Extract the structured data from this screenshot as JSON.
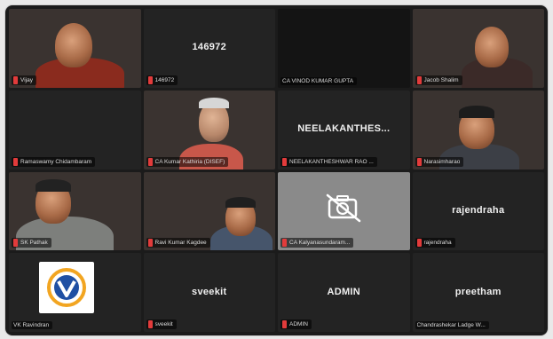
{
  "meeting": {
    "tiles": [
      {
        "name": "Vijay",
        "text": ""
      },
      {
        "name": "146972",
        "text": "146972"
      },
      {
        "name": "CA VINOD KUMAR GUPTA",
        "text": ""
      },
      {
        "name": "Jacob Shalim",
        "text": ""
      },
      {
        "name": "Ramaswamy Chidambaram",
        "text": ""
      },
      {
        "name": "CA Kumar Kathiria (DISEF)",
        "text": ""
      },
      {
        "name": "NEELAKANTHESHWAR RAO ...",
        "text": "NEELAKANTHES..."
      },
      {
        "name": "Narasimharao",
        "text": ""
      },
      {
        "name": "SK Pathak",
        "text": ""
      },
      {
        "name": "Ravi Kumar Kagdee",
        "text": ""
      },
      {
        "name": "CA Kalyanasundaram...",
        "text": ""
      },
      {
        "name": "rajendraha",
        "text": "rajendraha"
      },
      {
        "name": "VK Ravindran",
        "text": ""
      },
      {
        "name": "sveekit",
        "text": "sveekit"
      },
      {
        "name": "ADMIN",
        "text": "ADMIN"
      },
      {
        "name": "Chandrashekar Ladge W...",
        "text": "preetham"
      }
    ]
  },
  "icons": {
    "muted_mic": "mic-muted-icon",
    "camera_off": "camera-off-icon"
  },
  "colors": {
    "background": "#1b1b1b",
    "tile": "#232323",
    "mic_muted": "#e23b3b"
  }
}
